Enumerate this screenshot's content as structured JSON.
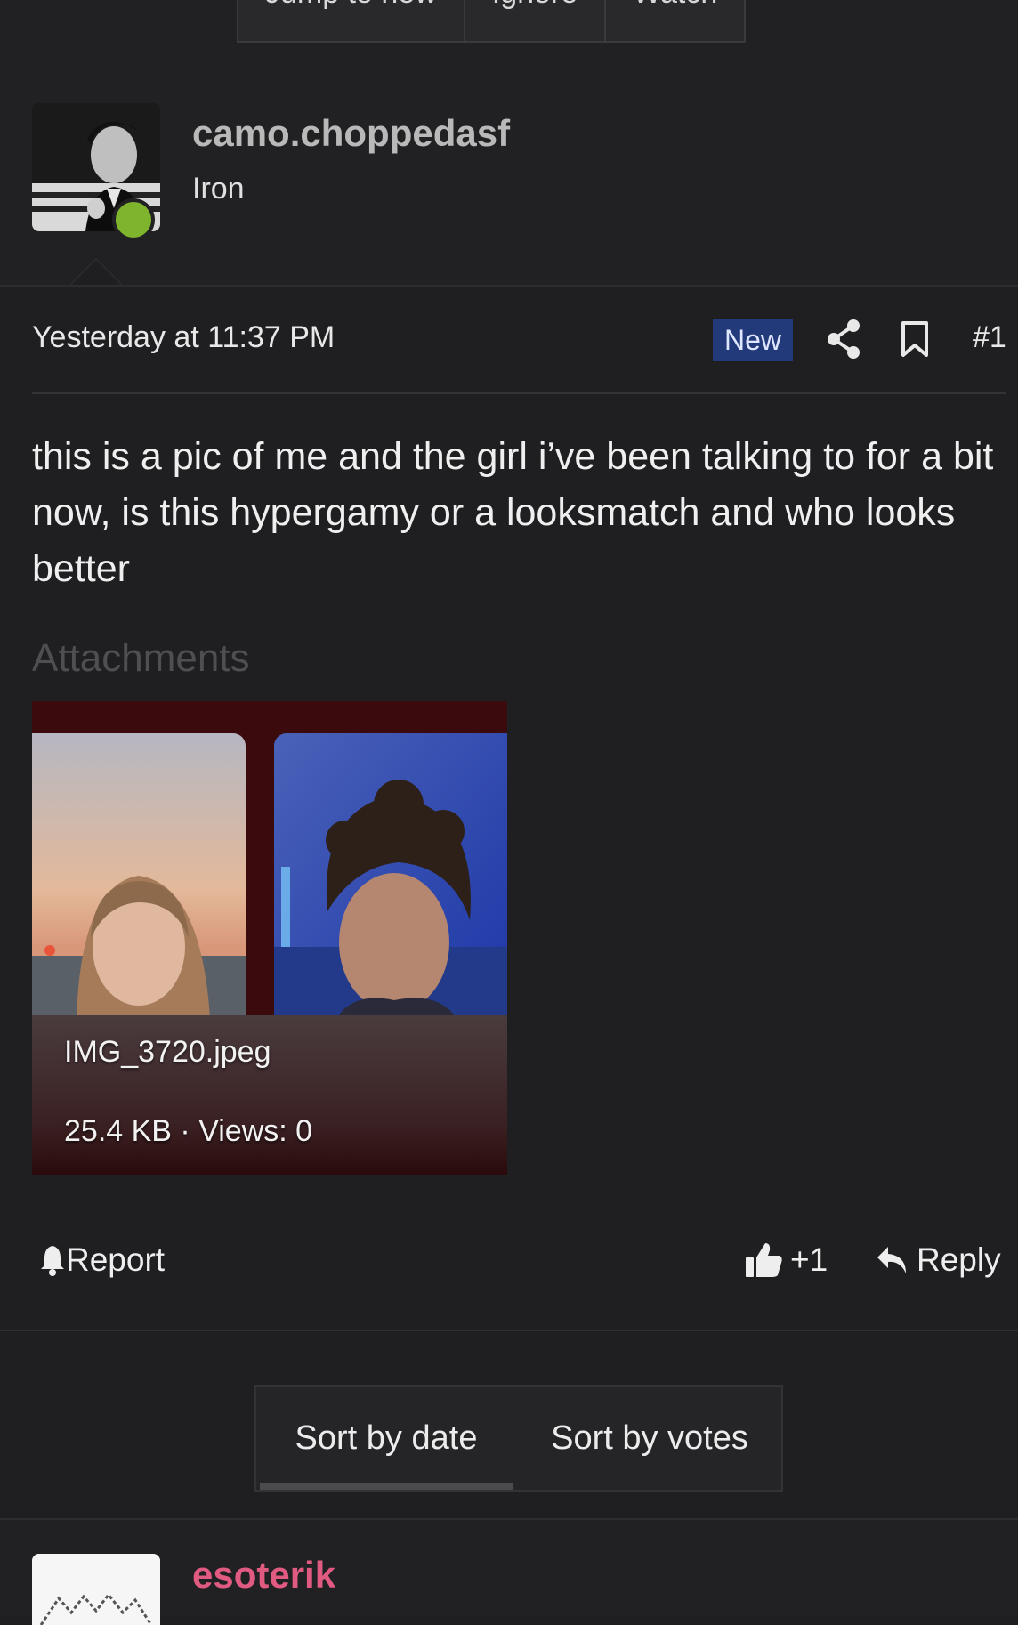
{
  "thread_actions": {
    "jump": "Jump to new",
    "ignore": "Ignore",
    "watch": "Watch"
  },
  "post": {
    "username": "camo.choppedasf",
    "user_title": "Iron",
    "timestamp": "Yesterday at 11:37 PM",
    "badge": "New",
    "post_number": "#1",
    "message": "this is a pic of me and the girl i’ve been talking to for a bit now, is this hypergamy or a looksmatch and who looks better",
    "attachments_title": "Attachments",
    "attachment": {
      "filename": "IMG_3720.jpeg",
      "meta": "25.4 KB · Views: 0"
    },
    "actions": {
      "report": "Report",
      "like": "+1",
      "reply": "Reply"
    }
  },
  "sort": {
    "by_date": "Sort by date",
    "by_votes": "Sort by votes",
    "active": "by_date"
  },
  "next_post": {
    "username": "esoterik"
  },
  "colors": {
    "background": "#1f1f21",
    "online": "#7eb52c",
    "new_badge": "#223a7a",
    "next_username": "#e05a82"
  },
  "icons": [
    "share-icon",
    "bookmark-icon",
    "bell-icon",
    "thumbs-up-icon",
    "reply-arrow-icon"
  ]
}
